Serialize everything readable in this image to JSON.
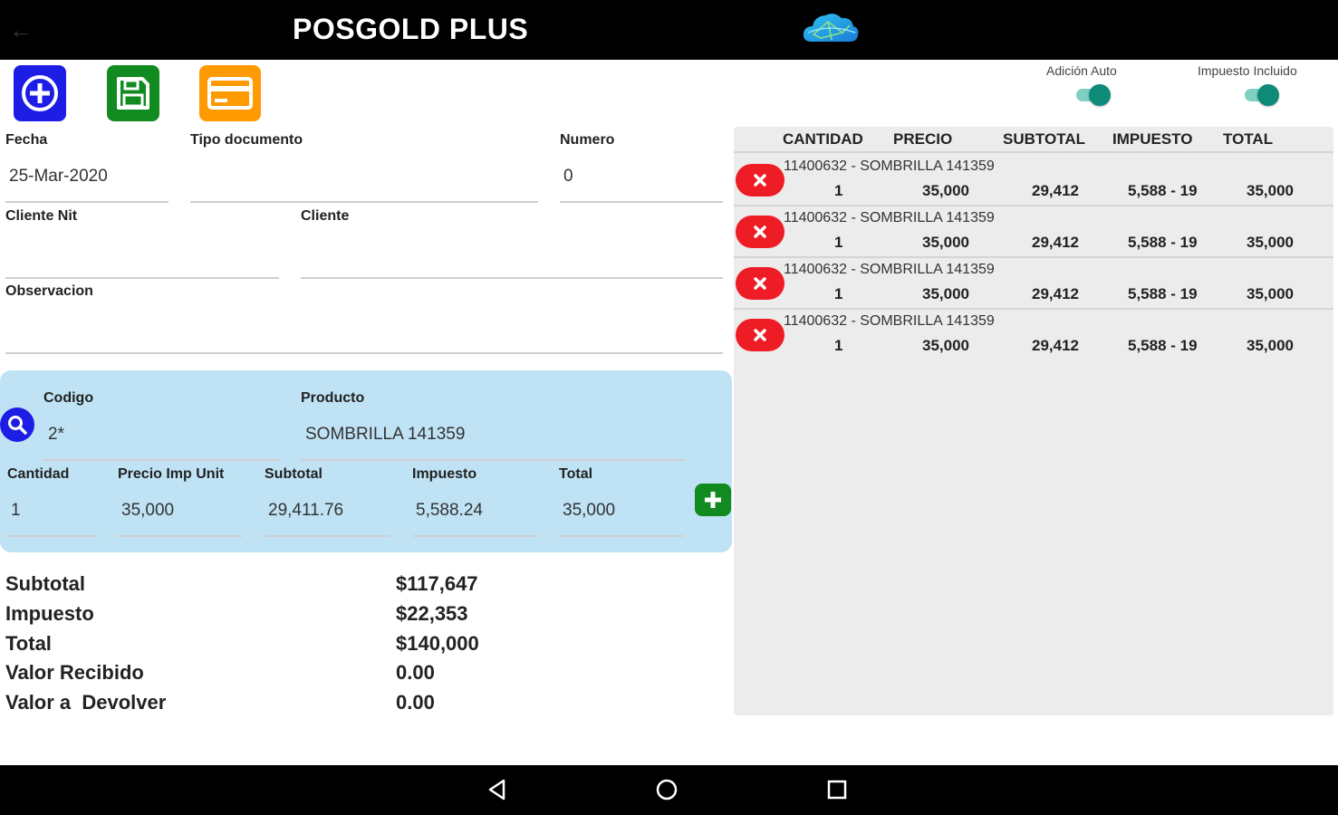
{
  "app": {
    "title": "POSGOLD PLUS"
  },
  "toggles": [
    {
      "label": "Adición Auto",
      "on": true
    },
    {
      "label": "Impuesto Incluido",
      "on": true
    }
  ],
  "form": {
    "fecha_label": "Fecha",
    "fecha_value": "25-Mar-2020",
    "tipo_label": "Tipo documento",
    "tipo_value": "",
    "numero_label": "Numero",
    "numero_value": "0",
    "cliente_nit_label": "Cliente Nit",
    "cliente_nit_value": "",
    "cliente_label": "Cliente",
    "cliente_value": "",
    "observacion_label": "Observacion",
    "observacion_value": ""
  },
  "product": {
    "codigo_label": "Codigo",
    "codigo_value": "2*",
    "producto_label": "Producto",
    "producto_value": "SOMBRILLA 141359",
    "cantidad_label": "Cantidad",
    "cantidad_value": "1",
    "precio_label": "Precio Imp Unit",
    "precio_value": "35,000",
    "subtotal_label": "Subtotal",
    "subtotal_value": "29,411.76",
    "impuesto_label": "Impuesto",
    "impuesto_value": "5,588.24",
    "total_label": "Total",
    "total_value": "35,000"
  },
  "totals": [
    {
      "label": "Subtotal",
      "value": "$117,647"
    },
    {
      "label": "Impuesto",
      "value": "$22,353"
    },
    {
      "label": "Total",
      "value": "$140,000"
    },
    {
      "label": "Valor Recibido",
      "value": "0.00"
    },
    {
      "label": "Valor a  Devolver",
      "value": "0.00"
    }
  ],
  "table": {
    "headers": [
      "CANTIDAD",
      "PRECIO",
      "SUBTOTAL",
      "IMPUESTO",
      "TOTAL"
    ],
    "rows": [
      {
        "desc": "11400632 - SOMBRILLA 141359",
        "cantidad": "1",
        "precio": "35,000",
        "subtotal": "29,412",
        "impuesto": "5,588 - 19",
        "total": "35,000"
      },
      {
        "desc": "11400632 - SOMBRILLA 141359",
        "cantidad": "1",
        "precio": "35,000",
        "subtotal": "29,412",
        "impuesto": "5,588 - 19",
        "total": "35,000"
      },
      {
        "desc": "11400632 - SOMBRILLA 141359",
        "cantidad": "1",
        "precio": "35,000",
        "subtotal": "29,412",
        "impuesto": "5,588 - 19",
        "total": "35,000"
      },
      {
        "desc": "11400632 - SOMBRILLA 141359",
        "cantidad": "1",
        "precio": "35,000",
        "subtotal": "29,412",
        "impuesto": "5,588 - 19",
        "total": "35,000"
      }
    ]
  },
  "colors": {
    "topbar": "#000000",
    "add_button": "#1d1de6",
    "save_button": "#118a1f",
    "card_button": "#ff9a00",
    "product_panel": "#bfe3f5",
    "delete_button": "#ee1c25",
    "toggle_on": "#0d8a78"
  },
  "icons": {
    "back": "arrow-left-icon",
    "logo": "cloud-logo-icon",
    "add": "plus-circle-icon",
    "save": "floppy-disk-icon",
    "card": "credit-card-icon",
    "search": "search-icon",
    "add_item": "plus-icon",
    "delete": "close-icon",
    "nav_back": "triangle-back-icon",
    "nav_home": "circle-home-icon",
    "nav_recent": "square-recent-icon"
  }
}
